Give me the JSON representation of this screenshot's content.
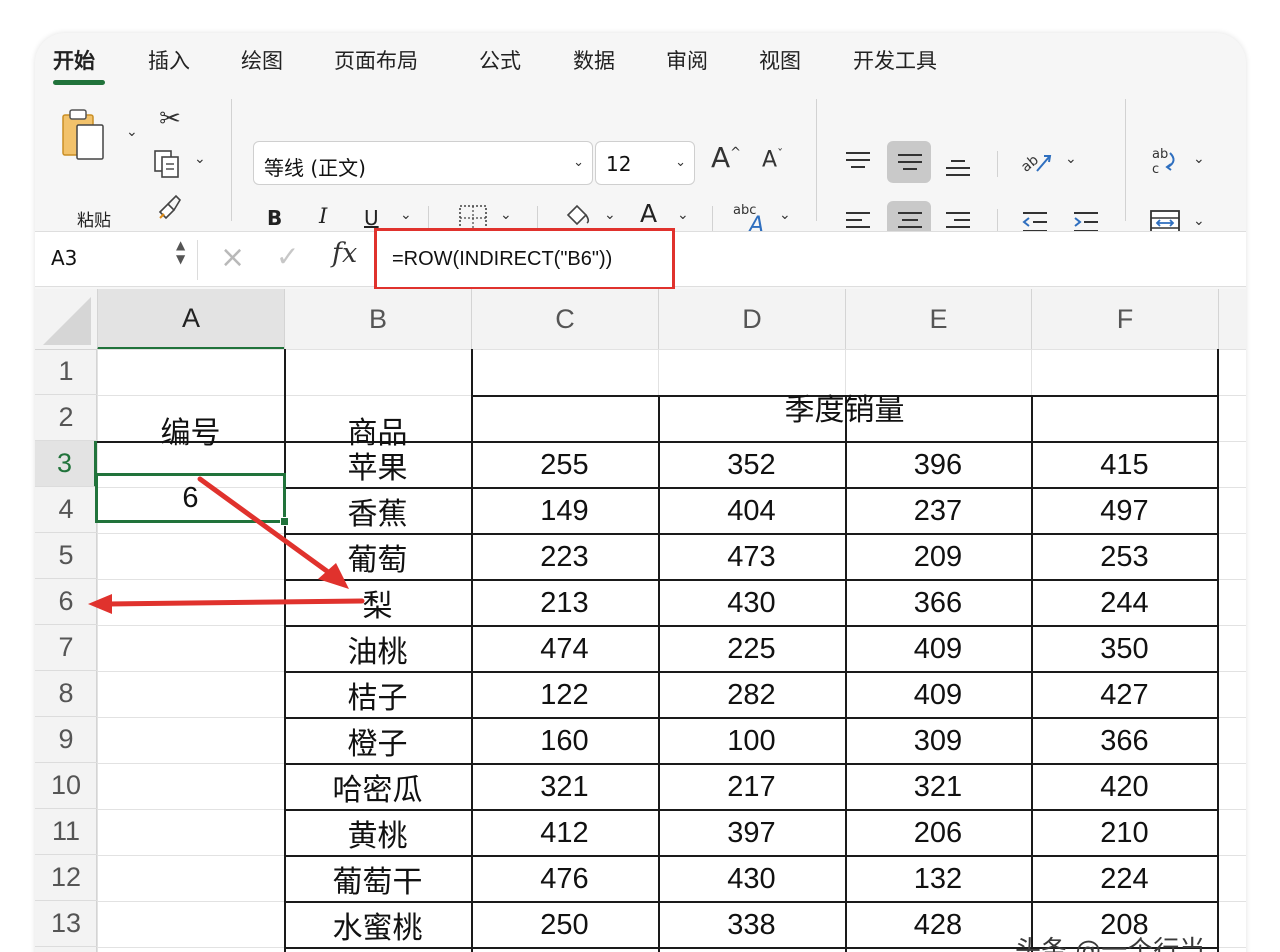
{
  "ribbon_tabs": [
    {
      "label": "开始",
      "active": true
    },
    {
      "label": "插入"
    },
    {
      "label": "绘图"
    },
    {
      "label": "页面布局"
    },
    {
      "label": "公式"
    },
    {
      "label": "数据"
    },
    {
      "label": "审阅"
    },
    {
      "label": "视图"
    },
    {
      "label": "开发工具"
    }
  ],
  "clipboard": {
    "paste_label": "粘贴"
  },
  "font": {
    "name": "等线 (正文)",
    "size": "12",
    "bold": "B",
    "italic": "I",
    "underline": "U",
    "grow": "A",
    "shrink": "A",
    "font_color_letter": "A",
    "phonetic": "abc",
    "highlight_color": "#f7e500",
    "font_color": "#e0322d"
  },
  "formula_bar": {
    "name_box": "A3",
    "fx": "fx",
    "formula": "=ROW(INDIRECT(\"B6\"))"
  },
  "grid": {
    "columns": [
      "A",
      "B",
      "C",
      "D",
      "E",
      "F"
    ],
    "selected_column": "A",
    "rows": [
      "1",
      "2",
      "3",
      "4",
      "5",
      "6",
      "7",
      "8",
      "9",
      "10",
      "11",
      "12",
      "13"
    ],
    "selected_row": "3",
    "header_id": "编号",
    "header_product": "商品",
    "header_sales": "季度销量",
    "a3_value": "6",
    "data": [
      {
        "product": "苹果",
        "values": [
          "255",
          "352",
          "396",
          "415"
        ]
      },
      {
        "product": "香蕉",
        "values": [
          "149",
          "404",
          "237",
          "497"
        ]
      },
      {
        "product": "葡萄",
        "values": [
          "223",
          "473",
          "209",
          "253"
        ]
      },
      {
        "product": "梨",
        "values": [
          "213",
          "430",
          "366",
          "244"
        ]
      },
      {
        "product": "油桃",
        "values": [
          "474",
          "225",
          "409",
          "350"
        ]
      },
      {
        "product": "桔子",
        "values": [
          "122",
          "282",
          "409",
          "427"
        ]
      },
      {
        "product": "橙子",
        "values": [
          "160",
          "100",
          "309",
          "366"
        ]
      },
      {
        "product": "哈密瓜",
        "values": [
          "321",
          "217",
          "321",
          "420"
        ]
      },
      {
        "product": "黄桃",
        "values": [
          "412",
          "397",
          "206",
          "210"
        ]
      },
      {
        "product": "葡萄干",
        "values": [
          "476",
          "430",
          "132",
          "224"
        ]
      },
      {
        "product": "水蜜桃",
        "values": [
          "250",
          "338",
          "428",
          "208"
        ]
      }
    ]
  },
  "colors": {
    "accent_green": "#21733b",
    "annotation_red": "#e0322d"
  },
  "watermark": "头条 @一个行当"
}
